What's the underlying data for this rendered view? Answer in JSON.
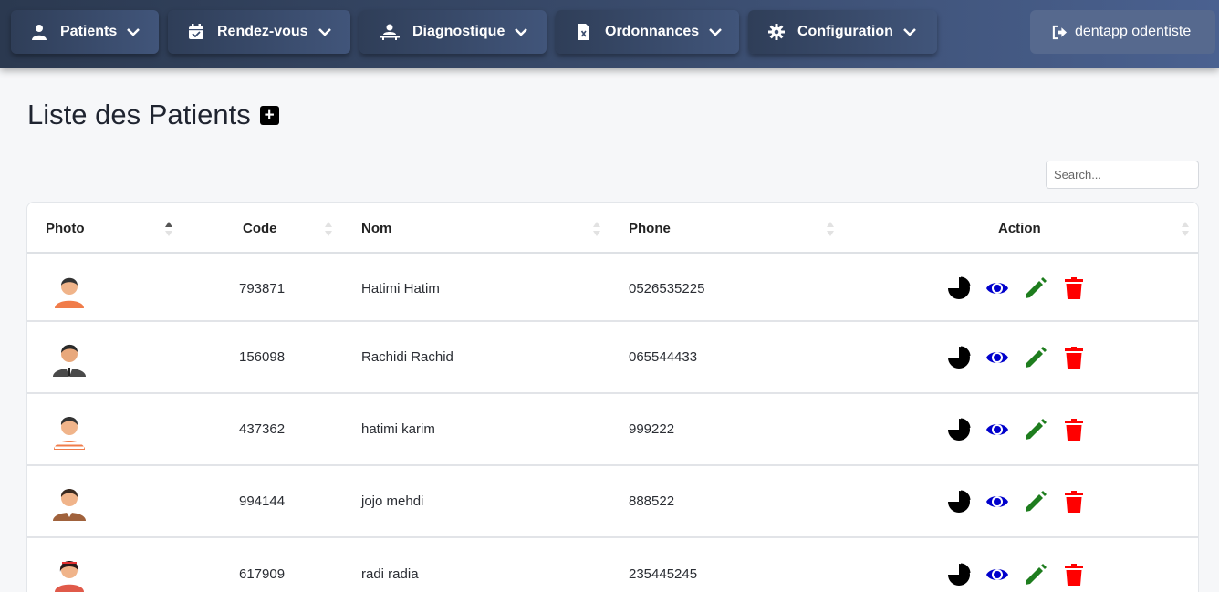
{
  "nav": {
    "patients": "Patients",
    "rendezvous": "Rendez-vous",
    "diagnostique": "Diagnostique",
    "ordonnances": "Ordonnances",
    "configuration": "Configuration",
    "logout": "dentapp odentiste"
  },
  "page": {
    "title": "Liste des Patients"
  },
  "search": {
    "placeholder": "Search..."
  },
  "table": {
    "columns": {
      "photo": "Photo",
      "code": "Code",
      "nom": "Nom",
      "phone": "Phone",
      "action": "Action"
    },
    "rows": [
      {
        "code": "793871",
        "nom": "Hatimi Hatim",
        "phone": "0526535225",
        "avatar": "avatar-man-orange-shirt"
      },
      {
        "code": "156098",
        "nom": "Rachidi Rachid",
        "phone": "065544433",
        "avatar": "avatar-man-suit"
      },
      {
        "code": "437362",
        "nom": "hatimi karim",
        "phone": "999222",
        "avatar": "avatar-man-striped-shirt"
      },
      {
        "code": "994144",
        "nom": "jojo mehdi",
        "phone": "888522",
        "avatar": "avatar-man-brown-jacket"
      },
      {
        "code": "617909",
        "nom": "radi radia",
        "phone": "235445245",
        "avatar": "avatar-woman-red-top"
      }
    ]
  },
  "colors": {
    "nav_start": "#2b3950",
    "nav_end": "#4a6190",
    "stats_icon": "#000000",
    "view_icon": "#0000cc",
    "edit_icon": "#1e7d1e",
    "delete_icon": "#ff0000"
  }
}
